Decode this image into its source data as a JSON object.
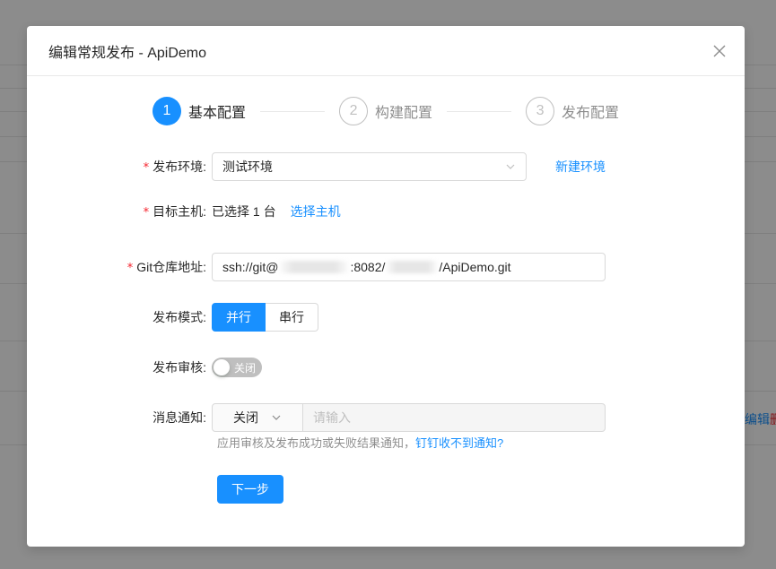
{
  "modal": {
    "title": "编辑常规发布 - ApiDemo"
  },
  "steps": [
    {
      "number": "1",
      "title": "基本配置",
      "status": "active"
    },
    {
      "number": "2",
      "title": "构建配置",
      "status": "wait"
    },
    {
      "number": "3",
      "title": "发布配置",
      "status": "wait"
    }
  ],
  "form": {
    "env": {
      "label": "发布环境:",
      "value": "测试环境",
      "link": "新建环境"
    },
    "host": {
      "label": "目标主机:",
      "value": "已选择 1 台",
      "link": "选择主机"
    },
    "git": {
      "label": "Git仓库地址:",
      "prefix": "ssh://git@",
      "middle": ":8082/",
      "suffix": "/ApiDemo.git"
    },
    "mode": {
      "label": "发布模式:",
      "options": [
        "并行",
        "串行"
      ],
      "selected": "并行"
    },
    "review": {
      "label": "发布审核:",
      "switch_text": "关闭",
      "on": false
    },
    "notify": {
      "label": "消息通知:",
      "select_value": "关闭",
      "placeholder": "请输入",
      "help_text": "应用审核及发布成功或失败结果通知，",
      "help_link": "钉钉收不到通知?"
    }
  },
  "actions": {
    "next_label": "下一步"
  },
  "background": {
    "row_links": [
      "编辑",
      "删"
    ]
  },
  "colors": {
    "primary": "#1890ff",
    "required": "#f5222d"
  }
}
